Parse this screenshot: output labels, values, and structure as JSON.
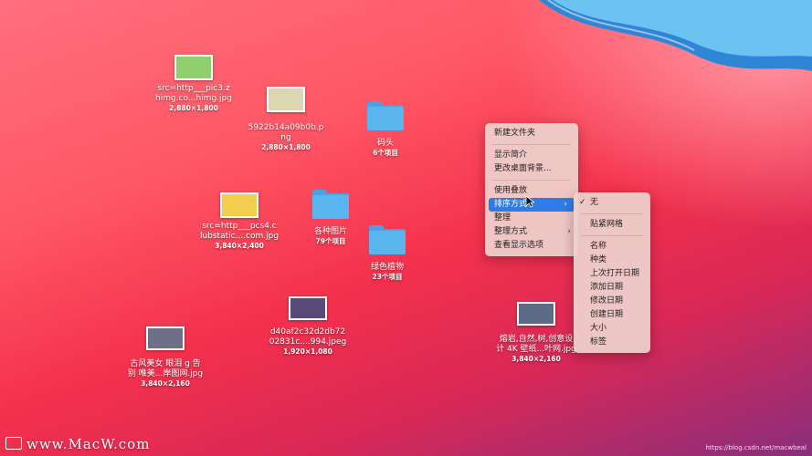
{
  "desktop_items": [
    {
      "name_lines": [
        "src=http___pic3.z",
        "himg.co...himg.jpg"
      ],
      "info": "2,880×1,800",
      "thumb_color": "#8fcf6e"
    },
    {
      "name_lines": [
        "5922b14a09b0b.p",
        "ng"
      ],
      "info": "2,880×1,800",
      "thumb_color": "#dcd6b2"
    },
    {
      "name_lines": [
        "码头"
      ],
      "info": "6个项目"
    },
    {
      "name_lines": [
        "src=http___pcs4.c",
        "lubstatic....com.jpg"
      ],
      "info": "3,840×2,400",
      "thumb_color": "#f2cf4e"
    },
    {
      "name_lines": [
        "各种图片"
      ],
      "info": "79个项目"
    },
    {
      "name_lines": [
        "绿色植物"
      ],
      "info": "23个项目"
    },
    {
      "name_lines": [
        "d40af2c32d2db72",
        "02831c....994.jpeg"
      ],
      "info": "1,920×1,080",
      "thumb_color": "#5a4a7a"
    },
    {
      "name_lines": [
        "古风美女 眼泪 g 告",
        "别 唯美...岸图网.jpg"
      ],
      "info": "3,840×2,160",
      "thumb_color": "#6d6f86"
    },
    {
      "name_lines": [
        "熔岩,自然,树,创意设",
        "计 4K 壁纸...叶网.jpg"
      ],
      "info": "3,840×2,160",
      "thumb_color": "#5c6b86"
    }
  ],
  "context_menu": {
    "items": [
      {
        "label": "新建文件夹"
      },
      {
        "separator": true
      },
      {
        "label": "显示简介"
      },
      {
        "label": "更改桌面背景..."
      },
      {
        "separator": true
      },
      {
        "label": "使用叠放"
      },
      {
        "label": "排序方式",
        "submenu": true,
        "highlighted": true
      },
      {
        "label": "整理"
      },
      {
        "label": "整理方式",
        "submenu": true
      },
      {
        "label": "查看显示选项"
      }
    ]
  },
  "sort_submenu": {
    "items": [
      {
        "label": "无",
        "checked": true
      },
      {
        "separator": true
      },
      {
        "label": "贴紧网格"
      },
      {
        "separator": true
      },
      {
        "label": "名称"
      },
      {
        "label": "种类"
      },
      {
        "label": "上次打开日期"
      },
      {
        "label": "添加日期"
      },
      {
        "label": "修改日期"
      },
      {
        "label": "创建日期"
      },
      {
        "label": "大小"
      },
      {
        "label": "标签"
      }
    ],
    "check_glyph": "✓"
  },
  "submenu_arrow_glyph": "›",
  "watermark": "www.MacW.com",
  "url_credit": "https://blog.csdn.net/macwbeal",
  "colors": {
    "folder": "#5ab4ee",
    "folder_tab": "#4aa3de",
    "menu_highlight": "#2f7ce8"
  }
}
